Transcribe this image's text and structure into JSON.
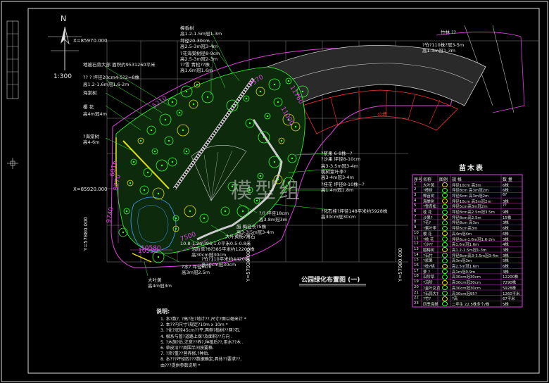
{
  "north": {
    "letter": "N",
    "scale": "1:300"
  },
  "coords": {
    "x_top": "X=85970.000",
    "x_mid": "X=85920.000",
    "y1": "Y=57880.000",
    "y2": "Y=57930.000",
    "y3": "Y=57980.000"
  },
  "title": {
    "main": "公园绿化布置图",
    "part": "(一)"
  },
  "watermark": "模型组",
  "park_label": "公墙",
  "dims": [
    "5210",
    "7570",
    "10580",
    "8770",
    "11000",
    "6016",
    "9740",
    "10530",
    "7500",
    "11760"
  ],
  "callouts_left": [
    "地被石蒜大部  面积约9531260平米",
    "?? ?  坪径20cm4-5?2=8株",
    "高1.2-1.6m冠1.6-2m",
    "海棠树",
    "樱  花",
    "高4m冠4m",
    "?海棠树",
    "高4-6m",
    "大叶黄",
    "高4m冠3m"
  ],
  "callouts_top": [
    "樟香树",
    "高1.2-1.5m冠1-3m",
    "坪径20-30cm",
    "高2.5-3m冠3-4m",
    "?花海棠树径8-9cm",
    "高2.5-3m冠2-3m",
    "??雪  青松??株",
    "高1.6m冠1.6m"
  ],
  "callouts_right": [
    "?浆果  6-8株~?",
    "?沙果  坪径8-10cm",
    "高3-3.5m冠3-4m",
    "桃树紫叶李?",
    "高3-4m冠3-4m",
    "?桂花  坪径8-10株~?",
    "高1.4m冠1.8m",
    "?化石桂?坪径148平米约5928株",
    "高30cm冠30cm"
  ],
  "callouts_bottom": [
    "?/?  坪径18cm",
    "高3.8m冠3m",
    "腊    梅径长?5株",
    "高3-3.5m冠3-4m",
    "大叶黄杨?篱石",
    "10.8-1.2m?96-1.0平米0.5-0.8米",
    "沿阶草?8?385平米约12200株",
    "高30cm冠30cm",
    "?竹?110平米约4420株",
    "高30cm冠30cm",
    "?水?  坪径6cm",
    "高3m冠2.5m"
  ],
  "callouts_top_right": [
    "竹林  ??",
    "?竹?110株?冠3-5m",
    "高1-3m冠1-3m"
  ],
  "table": {
    "title": "苗木表",
    "headers": [
      "序号",
      "名称",
      "图例",
      "规        格",
      "数 量"
    ],
    "rows": [
      [
        "1",
        "大叶黄",
        "",
        "坪径10cm  高3m",
        "6株"
      ],
      [
        "2",
        "?樟树",
        "",
        "坪径8cm 高3m冠2m",
        "6株"
      ],
      [
        "3",
        "樟苗树",
        "",
        "坪径6cm 高3m冠2m",
        "6?"
      ],
      [
        "4",
        "海棠树",
        "",
        "坪径10cm 高3m冠2m",
        "3株"
      ],
      [
        "5",
        "?雪青松",
        "",
        "坪径5cm高3m冠2m",
        "??"
      ],
      [
        "6",
        "桂  花",
        "",
        "坪径8cm高2.5m冠3.5m",
        "9株"
      ],
      [
        "7",
        "沙果?",
        "",
        "坪径8cm高2.5m",
        "15株"
      ],
      [
        "8",
        "?花?",
        "",
        "坪径8cm  高3m",
        "3株"
      ],
      [
        "9",
        "?紫叶李",
        "",
        "坪径6cm高3m",
        "6株"
      ],
      [
        "10",
        "樱  花",
        "",
        "高4m冠4m",
        "6株"
      ],
      [
        "11",
        "?桃  花",
        "",
        "坪径6cm1.6m冠1.6-2m",
        "3株"
      ],
      [
        "12",
        "?沙??",
        "",
        "高1.6m冠1.6m",
        "4株"
      ],
      [
        "13",
        "腊梅树",
        "",
        "高1.2-1.5m冠1-3m",
        "3株"
      ],
      [
        "14",
        "?石竹",
        "",
        "坪径8cm高3-3.5m冠3-4m",
        "3株"
      ],
      [
        "15",
        "?浆果",
        "",
        "高3m冠3m",
        "5株"
      ],
      [
        "16",
        "?枝?桃",
        "",
        "高2.5m冠1.6m",
        "6株"
      ],
      [
        "17",
        "萝  ?",
        "",
        "高1m冠0.9m",
        "3株"
      ],
      [
        "18",
        "沿阶草",
        "",
        "高30cm冠30cm",
        "12200株"
      ],
      [
        "19",
        "?沿阶",
        "",
        "高30cm冠30cm",
        "7290株"
      ],
      [
        "20",
        "?金叶女贞",
        "",
        "高30cm冠30cm",
        "5928株"
      ],
      [
        "21",
        "?石蒜大?",
        "",
        "高30cm冠95?",
        "1260平米"
      ],
      [
        "22",
        "?竹?",
        "",
        "?高",
        "67平米"
      ],
      [
        "23",
        "四季海棠",
        "",
        "二年生  22.5株多个/株",
        "5株"
      ]
    ]
  },
  "notes": {
    "title": "说明:",
    "lines": [
      "1. 本?数?, ?高?在?地计??,尺寸?面以毫米计 *",
      "2. 本??内尺寸?规定?10m x 10m *",
      "3. ?化?冠径45cm??平,两侧?植树??两?石.",
      "4. 根系与管?道路上保?及面积??方向 .",
      "5. ?木施?后,注意??养?,种植后??,用水??木 .",
      "6. 草皮沿??周围半间按要格.",
      "7. ?须?重??营养修,?种后.",
      "8. 本???坪径四???数据确定,具体??要求??,",
      "   由???提供参数说明 *"
    ]
  }
}
